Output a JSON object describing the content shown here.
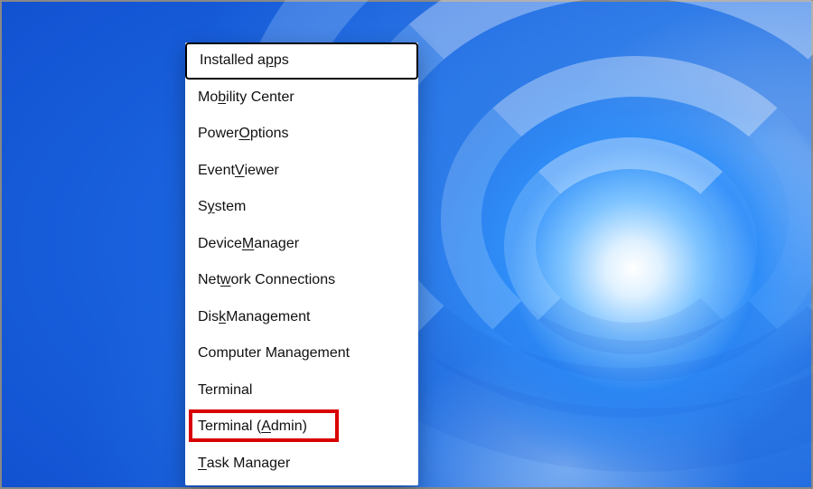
{
  "menu": {
    "items": [
      {
        "pre": "Installed a",
        "u": "p",
        "post": "ps"
      },
      {
        "pre": "Mo",
        "u": "b",
        "post": "ility Center"
      },
      {
        "pre": "Power ",
        "u": "O",
        "post": "ptions"
      },
      {
        "pre": "Event ",
        "u": "V",
        "post": "iewer"
      },
      {
        "pre": "S",
        "u": "y",
        "post": "stem"
      },
      {
        "pre": "Device ",
        "u": "M",
        "post": "anager"
      },
      {
        "pre": "Net",
        "u": "w",
        "post": "ork Connections"
      },
      {
        "pre": "Dis",
        "u": "k",
        "post": " Management"
      },
      {
        "pre": "Computer Mana",
        "u": "g",
        "post": "ement"
      },
      {
        "pre": "Terminal",
        "u": "",
        "post": ""
      },
      {
        "pre": "Terminal (",
        "u": "A",
        "post": "dmin)"
      },
      {
        "pre": "",
        "u": "T",
        "post": "ask Manager"
      }
    ],
    "highlighted_index": 10,
    "focused_index": 0
  },
  "colors": {
    "highlight": "#d90000",
    "menu_bg": "#ffffff",
    "text": "#111111"
  }
}
